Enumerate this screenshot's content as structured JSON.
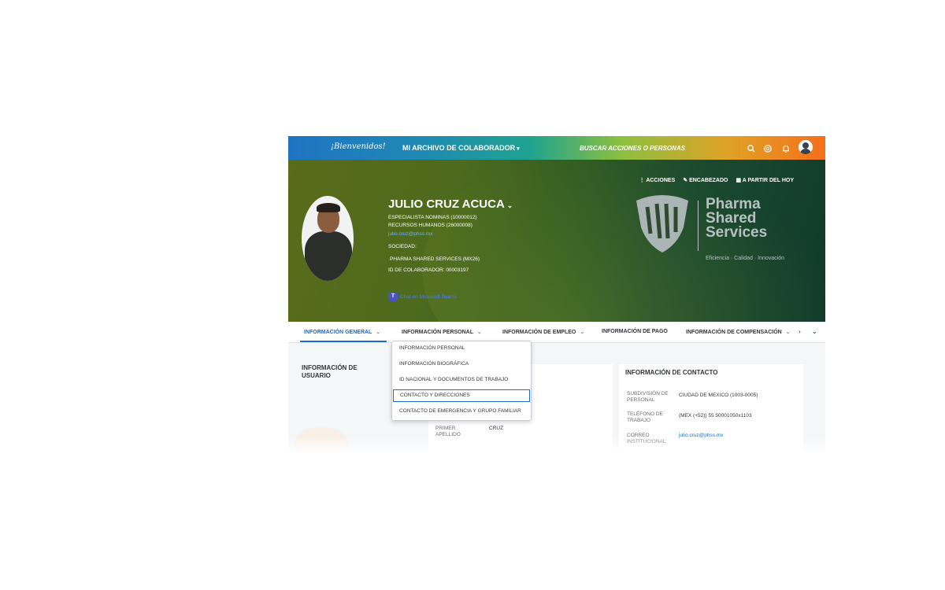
{
  "topbar": {
    "logo_text": "¡Bienvenidos!",
    "title_menu": "MI ARCHIVO DE COLABORADOR",
    "search_placeholder": "BUSCAR ACCIONES O PERSONAS",
    "icons": [
      "search-icon",
      "help-icon",
      "bell-icon",
      "user-avatar"
    ]
  },
  "header": {
    "actions": {
      "acciones": "ACCIONES",
      "encabezado": "ENCABEZADO",
      "a_partir": "A PARTIR DEL HOY"
    },
    "name": "JULIO CRUZ ACUCA",
    "position": "ESPECIALISTA NOMINAS (10000012)",
    "department": "RECURSOS HUMANOS (26000008)",
    "email": "julio.cruz@phss.mx",
    "sociedad_label": "SOCIEDAD:",
    "sociedad_value": "PHARMA SHARED SERVICES (MX26)",
    "id_label": "ID DE COLABORADOR: 00003197",
    "teams_link": "Chat en Microsoft Teams"
  },
  "brand": {
    "line1": "Pharma",
    "line2": "Shared",
    "line3": "Services",
    "slogan": "Eficiencia · Calidad · Innovación"
  },
  "tabs": [
    {
      "label": "INFORMACIÓN GENERAL",
      "active": true
    },
    {
      "label": "INFORMACIÓN PERSONAL",
      "active": false
    },
    {
      "label": "INFORMACIÓN DE EMPLEO",
      "active": false
    },
    {
      "label": "INFORMACIÓN DE PAGO",
      "active": false
    },
    {
      "label": "INFORMACIÓN DE COMPENSACIÓN",
      "active": false
    }
  ],
  "dropdown": {
    "items": [
      "INFORMACIÓN PERSONAL",
      "INFORMACIÓN BIOGRÁFICA",
      "ID NACIONAL Y DOCUMENTOS DE TRABAJO",
      "CONTACTO Y DIRECCIONES",
      "CONTACTO DE EMERGENCIA Y GRUPO FAMILIAR"
    ],
    "focused_item": "CONTACTO Y DIRECCIONES"
  },
  "content": {
    "sidebar_title": "INFORMACIÓN DE USUARIO",
    "personal_card": {
      "fields": [
        {
          "label": "PRIMER APELLIDO",
          "value": "CRUZ"
        }
      ]
    },
    "contact_card": {
      "title": "INFORMACIÓN DE CONTACTO",
      "fields": [
        {
          "label": "SUBDIVISIÓN DE PERSONAL",
          "value": "CIUDAD DE MEXICO (1003-0005)"
        },
        {
          "label": "TELÉFONO DE TRABAJO",
          "value": "(MEX (+52)) 55 50001050x1103"
        },
        {
          "label": "CORREO INSTITUCIONAL",
          "value": "julio.cruz@phss.mx"
        }
      ]
    }
  },
  "colors": {
    "accent_blue": "#1d6ccc",
    "topbar_left": "#1f74c2",
    "topbar_right": "#f4701c",
    "banner_dark": "#0f3a2c",
    "banner_olive": "#5a6b1a"
  }
}
